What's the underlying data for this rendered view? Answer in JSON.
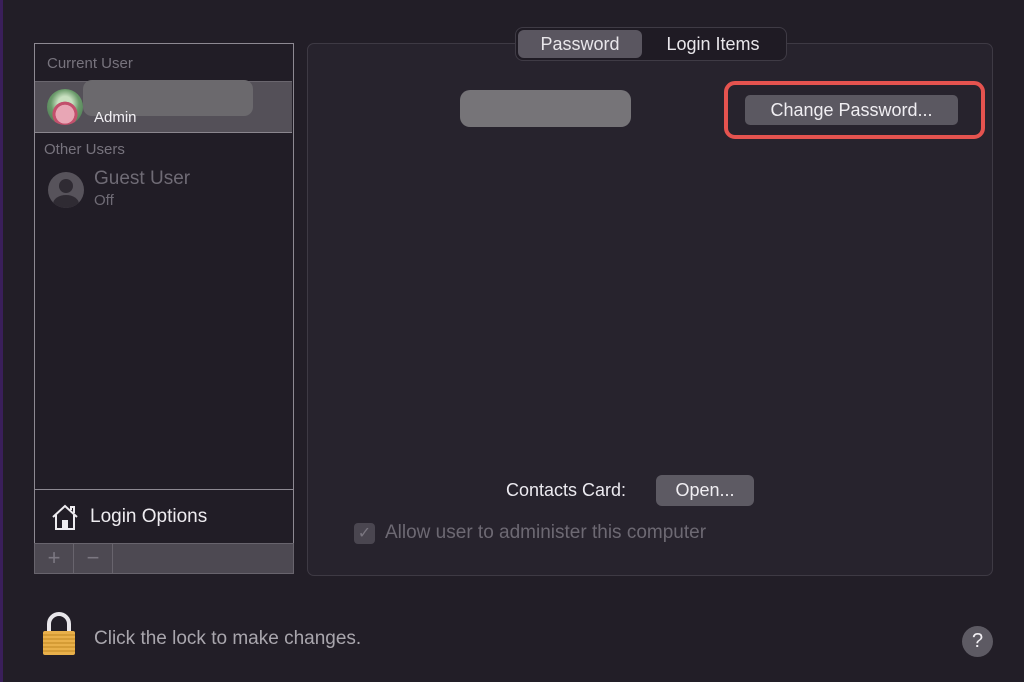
{
  "sidebar": {
    "current_user_label": "Current User",
    "current_user": {
      "name": "[redacted]",
      "role": "Admin",
      "avatar": "lotus-flower-avatar"
    },
    "other_users_label": "Other Users",
    "other_users": [
      {
        "name": "Guest User",
        "status": "Off",
        "avatar": "generic-user-avatar"
      }
    ],
    "login_options_label": "Login Options",
    "add_label": "+",
    "remove_label": "−"
  },
  "tabs": [
    {
      "label": "Password",
      "active": true
    },
    {
      "label": "Login Items",
      "active": false
    }
  ],
  "main": {
    "username_field": "[redacted]",
    "change_password_label": "Change Password...",
    "highlight_color": "#e5534f",
    "contacts_card_label": "Contacts Card:",
    "open_label": "Open...",
    "admin_checkbox_label": "Allow user to administer this computer",
    "admin_checkbox_checked": true,
    "admin_checkbox_enabled": false
  },
  "footer": {
    "lock_text": "Click the lock to make changes.",
    "help_label": "?"
  }
}
